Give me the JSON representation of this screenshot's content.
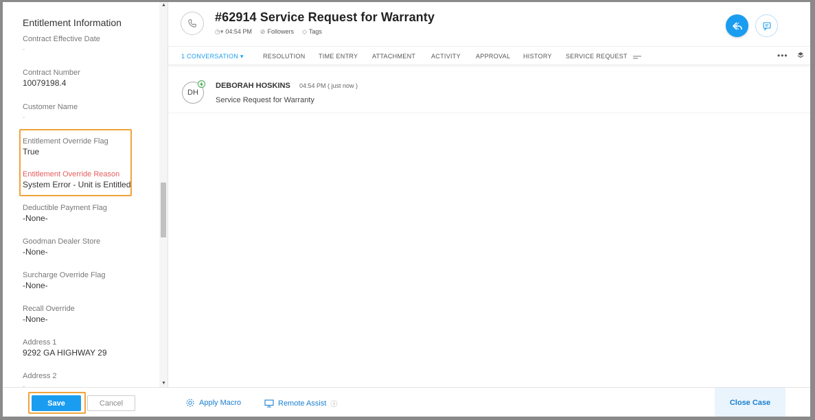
{
  "left_panel": {
    "section_title": "Entitlement Information",
    "fields": [
      {
        "label": "Contract Effective Date",
        "value": "-"
      },
      {
        "label": "Contract Number",
        "value": "10079198.4"
      },
      {
        "label": "Customer Name",
        "value": "-"
      },
      {
        "label": "Entitlement Override Flag",
        "value": "True"
      },
      {
        "label": "Entitlement Override Reason",
        "value": "System Error - Unit is Entitled"
      },
      {
        "label": "Deductible Payment Flag",
        "value": "-None-"
      },
      {
        "label": "Goodman Dealer Store",
        "value": "-None-"
      },
      {
        "label": "Surcharge Override Flag",
        "value": "-None-"
      },
      {
        "label": "Recall Override",
        "value": "-None-"
      },
      {
        "label": "Address 1",
        "value": "9292 GA HIGHWAY 29"
      },
      {
        "label": "Address 2",
        "value": "-"
      }
    ],
    "save_label": "Save",
    "cancel_label": "Cancel"
  },
  "header": {
    "ticket_title": "#62914  Service Request for Warranty",
    "time": "04:54 PM",
    "followers": "Followers",
    "tags": "Tags"
  },
  "tabs": [
    {
      "label": "1 CONVERSATION ▾"
    },
    {
      "label": "RESOLUTION"
    },
    {
      "label": "TIME ENTRY"
    },
    {
      "label": "ATTACHMENT"
    },
    {
      "label": "ACTIVITY"
    },
    {
      "label": "APPROVAL"
    },
    {
      "label": "HISTORY"
    },
    {
      "label": "SERVICE REQUEST"
    }
  ],
  "conversation": {
    "avatar_initials": "DH",
    "author": "DEBORAH HOSKINS",
    "time": "04:54 PM ( just now )",
    "message": "Service Request for Warranty"
  },
  "footer": {
    "apply_macro": "Apply Macro",
    "remote_assist": "Remote Assist",
    "close_case": "Close Case"
  },
  "colors": {
    "accent": "#1a9cf0",
    "highlight": "#f0a33a",
    "error_label": "#e45d5d"
  }
}
